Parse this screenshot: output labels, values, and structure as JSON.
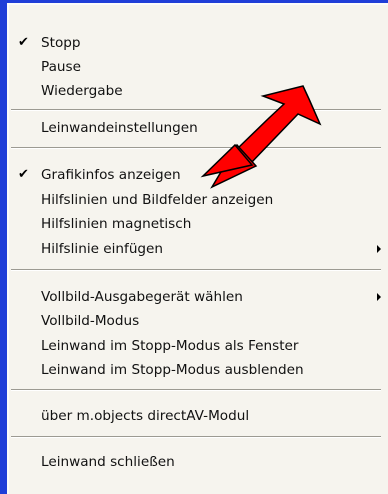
{
  "menu": {
    "items": [
      {
        "label": "Stopp",
        "checked": true,
        "submenu": false
      },
      {
        "label": "Pause",
        "checked": false,
        "submenu": false
      },
      {
        "label": "Wiedergabe",
        "checked": false,
        "submenu": false
      },
      {
        "label": "Leinwandeinstellungen",
        "checked": false,
        "submenu": false
      },
      {
        "label": "Grafikinfos anzeigen",
        "checked": true,
        "submenu": false
      },
      {
        "label": "Hilfslinien und Bildfelder anzeigen",
        "checked": false,
        "submenu": false
      },
      {
        "label": "Hilfslinien magnetisch",
        "checked": false,
        "submenu": false
      },
      {
        "label": "Hilfslinie einfügen",
        "checked": false,
        "submenu": true
      },
      {
        "label": "Vollbild-Ausgabegerät wählen",
        "checked": false,
        "submenu": true
      },
      {
        "label": "Vollbild-Modus",
        "checked": false,
        "submenu": false
      },
      {
        "label": "Leinwand im Stopp-Modus als Fenster",
        "checked": false,
        "submenu": false
      },
      {
        "label": "Leinwand im Stopp-Modus ausblenden",
        "checked": false,
        "submenu": false
      },
      {
        "label": "über m.objects directAV-Modul",
        "checked": false,
        "submenu": false
      },
      {
        "label": "Leinwand schließen",
        "checked": false,
        "submenu": false
      }
    ],
    "check_glyph": "✔"
  },
  "colors": {
    "background_blue": "#1f3ed8",
    "menu_face": "#f6f4ee",
    "annotation_arrow": "#ff0000"
  },
  "annotation": {
    "icon": "red-pointer-arrow-icon",
    "points_to": "Grafikinfos anzeigen"
  }
}
